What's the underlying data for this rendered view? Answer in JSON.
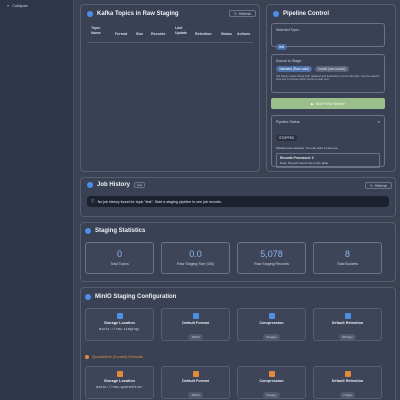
{
  "sidebar": {
    "collapse_label": "Collapse"
  },
  "topics": {
    "title": "Kafka Topics in Raw Staging",
    "refresh_label": "Refresh",
    "columns": [
      "Topic Name",
      "Format",
      "Size",
      "Records",
      "Last Update",
      "Retention",
      "Status",
      "Actions"
    ]
  },
  "pipeline": {
    "title": "Pipeline Control",
    "selected_topic_label": "Selected Topic:",
    "selected_topic": "test",
    "source_label": "Source to Stage:",
    "source_valid": "Validated (Raw-valid)",
    "source_invalid": "Invalid (raw-invalid)",
    "source_help": "Job history below shows both validated and quarantine runs for this topic. Use the selector here only to choose which source to start next.",
    "start_button": "Start Flink Pipeline",
    "status_label": "Pipeline Status:",
    "status_value": "STOPPED",
    "status_msg": "Pipeline has stopped. You can start a new one.",
    "records_label": "Records Processed: 0",
    "records_note": "Note: Per-job counts live in the table.",
    "note_prefix": "Note:"
  },
  "jobs": {
    "title": "Job History",
    "badge": "test",
    "refresh_label": "Refresh",
    "empty_msg": "No job history found for topic \"test\". Start a staging pipeline to see job records."
  },
  "stats": {
    "title": "Staging Statistics",
    "items": [
      {
        "value": "0",
        "label": "Total Topics"
      },
      {
        "value": "0.0",
        "label": "Raw Staging Size (GB)"
      },
      {
        "value": "5,078",
        "label": "Raw Staging Records"
      },
      {
        "value": "8",
        "label": "Total Buckets"
      }
    ]
  },
  "minio": {
    "title": "MinIO Staging Configuration",
    "raw": [
      {
        "title": "Storage Location",
        "value": "minio://raw-staging/",
        "icon": "folder-icon"
      },
      {
        "title": "Default Format",
        "value": "JSON",
        "icon": "file-icon"
      },
      {
        "title": "Compression",
        "value": "Snappy",
        "icon": "compress-icon"
      },
      {
        "title": "Default Retention",
        "value": "90 days",
        "icon": "clock-icon"
      }
    ],
    "quarantine_title": "Quarantine (Invalid) Defaults",
    "quarantine": [
      {
        "title": "Storage Location",
        "value": "minio://raw-quarantine/",
        "icon": "folder-icon"
      },
      {
        "title": "Default Format",
        "value": "JSON",
        "icon": "file-icon"
      },
      {
        "title": "Compression",
        "value": "Snappy",
        "icon": "compress-icon"
      },
      {
        "title": "Default Retention",
        "value": "7 days",
        "icon": "clock-icon"
      }
    ]
  },
  "colors": {
    "accent": "#4d8fe8",
    "warning": "#e08a3a",
    "success_button": "#9bbf8a",
    "stat_value": "#8fb7f3"
  }
}
